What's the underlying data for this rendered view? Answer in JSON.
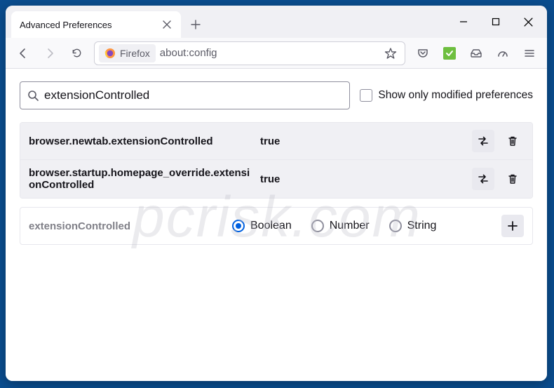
{
  "tab": {
    "title": "Advanced Preferences"
  },
  "identity": {
    "label": "Firefox"
  },
  "url": "about:config",
  "search": {
    "value": "extensionControlled"
  },
  "showOnlyModified": {
    "label": "Show only modified preferences",
    "checked": false
  },
  "prefs": [
    {
      "name": "browser.newtab.extensionControlled",
      "value": "true"
    },
    {
      "name": "browser.startup.homepage_override.extensionControlled",
      "value": "true"
    }
  ],
  "newpref": {
    "name": "extensionControlled",
    "types": [
      "Boolean",
      "Number",
      "String"
    ],
    "selected": "Boolean"
  },
  "watermark": "pcrisk.com"
}
